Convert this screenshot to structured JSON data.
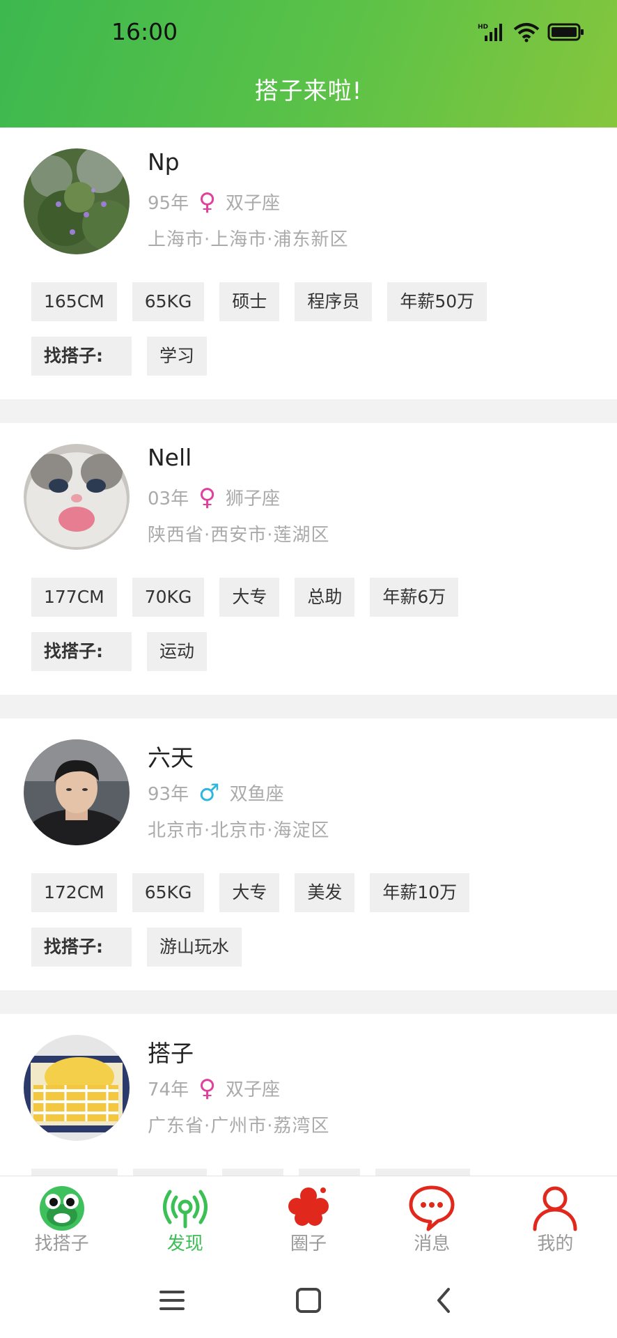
{
  "status": {
    "time": "16:00"
  },
  "header": {
    "title": "搭子来啦!"
  },
  "profiles": [
    {
      "name": "Np",
      "year": "95年",
      "gender": "female",
      "gender_symbol": "♀",
      "zodiac": "双子座",
      "location": "上海市·上海市·浦东新区",
      "tags": [
        "165CM",
        "65KG",
        "硕士",
        "程序员",
        "年薪50万"
      ],
      "seek_label": "找搭子:",
      "seek_value": "学习"
    },
    {
      "name": "Nell",
      "year": "03年",
      "gender": "female",
      "gender_symbol": "♀",
      "zodiac": "狮子座",
      "location": "陕西省·西安市·莲湖区",
      "tags": [
        "177CM",
        "70KG",
        "大专",
        "总助",
        "年薪6万"
      ],
      "seek_label": "找搭子:",
      "seek_value": "运动"
    },
    {
      "name": "六天",
      "year": "93年",
      "gender": "male",
      "gender_symbol": "♂",
      "zodiac": "双鱼座",
      "location": "北京市·北京市·海淀区",
      "tags": [
        "172CM",
        "65KG",
        "大专",
        "美发",
        "年薪10万"
      ],
      "seek_label": "找搭子:",
      "seek_value": "游山玩水"
    },
    {
      "name": "搭子",
      "year": "74年",
      "gender": "female",
      "gender_symbol": "♀",
      "zodiac": "双子座",
      "location": "广东省·广州市·荔湾区",
      "tags": [
        "",
        "",
        "",
        "",
        ""
      ],
      "seek_label": "",
      "seek_value": ""
    }
  ],
  "nav": [
    {
      "label": "找搭子",
      "icon": "frog-icon",
      "active": false
    },
    {
      "label": "发现",
      "icon": "broadcast-icon",
      "active": true
    },
    {
      "label": "圈子",
      "icon": "clover-icon",
      "active": false
    },
    {
      "label": "消息",
      "icon": "chat-bubble-icon",
      "active": false
    },
    {
      "label": "我的",
      "icon": "person-icon",
      "active": false
    }
  ],
  "colors": {
    "header_start": "#3cb84f",
    "header_end": "#86c63d",
    "active": "#3cbf55",
    "female": "#e0409b",
    "male": "#2eb6e0",
    "accent_red": "#e0281c"
  }
}
